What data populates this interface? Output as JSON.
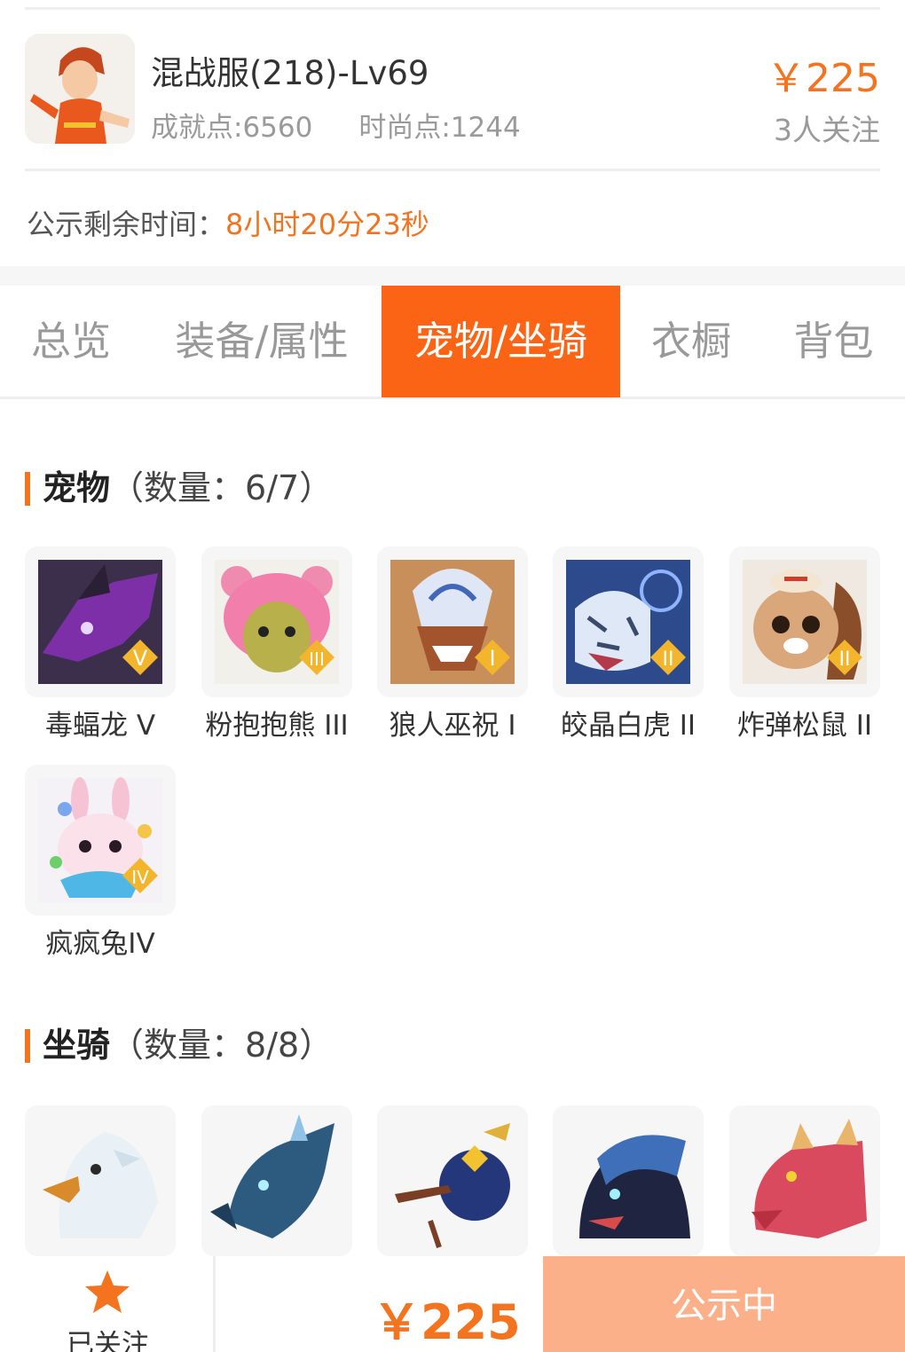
{
  "character": {
    "name": "混战服(218)-Lv69",
    "achievement": "成就点:6560",
    "fashion": "时尚点:1244",
    "price": "￥225",
    "followers": "3人关注"
  },
  "countdown": {
    "label": "公示剩余时间：",
    "value": "8小时20分23秒"
  },
  "tabs": [
    {
      "label": "总览"
    },
    {
      "label": "装备/属性"
    },
    {
      "label": "宠物/坐骑",
      "active": true
    },
    {
      "label": "衣橱"
    },
    {
      "label": "背包"
    }
  ],
  "pets": {
    "title": "宠物",
    "count": "（数量：6/7）",
    "items": [
      {
        "name": "毒蝠龙 V",
        "icon": "poison-bat-dragon-icon"
      },
      {
        "name": "粉抱抱熊 III",
        "icon": "pink-hug-bear-icon"
      },
      {
        "name": "狼人巫祝 I",
        "icon": "werewolf-shaman-icon"
      },
      {
        "name": "皎晶白虎 II",
        "icon": "crystal-white-tiger-icon"
      },
      {
        "name": "炸弹松鼠 II",
        "icon": "bomb-squirrel-icon"
      },
      {
        "name": "疯疯兔IV",
        "icon": "crazy-rabbit-icon"
      }
    ]
  },
  "mounts": {
    "title": "坐骑",
    "count": "（数量：8/8）",
    "items": [
      {
        "icon": "white-eagle-icon"
      },
      {
        "icon": "blue-dragon-icon"
      },
      {
        "icon": "broom-orb-icon"
      },
      {
        "icon": "armored-panther-icon"
      },
      {
        "icon": "red-dragon-icon"
      }
    ]
  },
  "bottom_bar": {
    "follow_label": "已关注",
    "price": "￥225",
    "status_label": "公示中"
  },
  "colors": {
    "accent": "#f4731e",
    "active_tab": "#fa6414",
    "status_button": "#fbb08a"
  }
}
